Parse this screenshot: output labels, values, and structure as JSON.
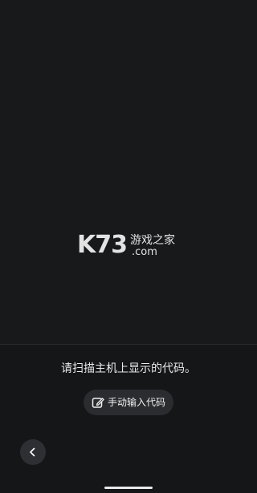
{
  "scanner": {
    "watermark": {
      "logo": "K73",
      "site_name": "游戏之家",
      "domain": ".com"
    }
  },
  "instructions": {
    "prompt": "请扫描主机上显示的代码。"
  },
  "manual_entry": {
    "label": "手动输入代码",
    "icon": "edit-icon"
  },
  "navigation": {
    "back_icon": "chevron-left-icon"
  },
  "colors": {
    "background": "#151618",
    "camera_background": "#18191b",
    "button_background": "#2b2c2f",
    "text": "#ffffff"
  }
}
